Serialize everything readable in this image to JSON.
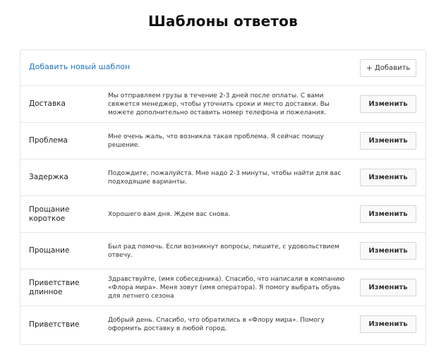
{
  "page": {
    "title": "Шаблоны ответов"
  },
  "header": {
    "add_link": "Добавить новый шаблон",
    "add_button": "+ Добавить",
    "add_button_plus": "+",
    "add_button_label": "Добавить"
  },
  "templates": [
    {
      "name": "Доставка",
      "text": "Мы отправляем грузы в течение 2-3 дней после оплаты. С вами свяжется менеджер, чтобы уточнить сроки и место доставки. Вы можете дополнительно оставить номер телефона и пожелания.",
      "edit": "Изменить"
    },
    {
      "name": "Проблема",
      "text": "Мне очень жаль, что возникла такая проблема. Я сейчас поищу решение.",
      "edit": "Изменить"
    },
    {
      "name": "Задержка",
      "text": "Подождите, пожалуйста. Мне надо 2-3 минуты, чтобы найти для вас подходящие варианты.",
      "edit": "Изменить"
    },
    {
      "name": "Прощание короткое",
      "text": "Хорошего вам дня. Ждем вас снова.",
      "edit": "Изменить"
    },
    {
      "name": "Прощание",
      "text": "Был рад помочь. Если возникнут вопросы, пишите, с удовольствием отвечу.",
      "edit": "Изменить"
    },
    {
      "name": "Приветствие длинное",
      "text": "Здравствуйте, (имя собеседника). Спасибо, что написали в компанию «Флора мира». Меня зовут (имя оператора). Я помогу выбрать обувь для летнего сезона",
      "edit": "Изменить"
    },
    {
      "name": "Приветствие",
      "text": "Добрый день. Спасибо, что обратились в «Флору мира». Помогу оформить доставку в любой город.",
      "edit": "Изменить"
    }
  ],
  "colors": {
    "link": "#1e73be",
    "border": "#e3e3e3",
    "text": "#222222"
  }
}
